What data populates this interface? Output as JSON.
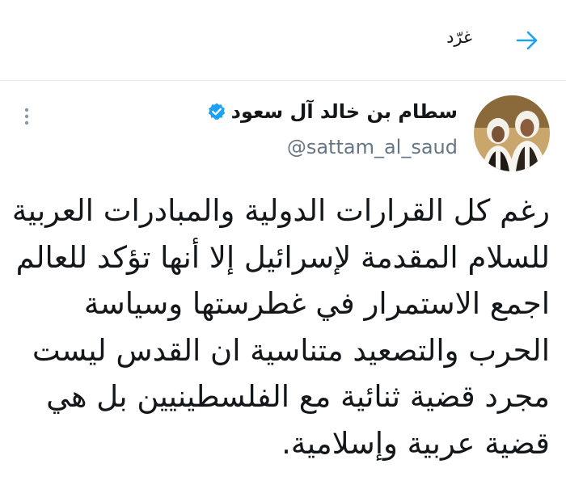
{
  "header": {
    "title": "غرّد",
    "back_icon": "arrow-right-icon",
    "accent_color": "#1da1f2"
  },
  "tweet": {
    "author": {
      "display_name": "سطام بن خالد آل سعود",
      "handle": "@sattam_al_saud",
      "verified": true,
      "verified_icon": "verified-badge-icon",
      "avatar_icon": "profile-photo"
    },
    "more_icon": "caret-down-icon",
    "text_lines": [
      "رغم كل القرارات الدولية والمبادرات العربية",
      "للسلام المقدمة لإسرائيل إلا أنها تؤكد للعالم",
      "اجمع الاستمرار في غطرستها وسياسة",
      "الحرب والتصعيد متناسية ان القدس ليست",
      "مجرد قضية ثنائية مع الفلسطينيين بل هي",
      "قضية عربية وإسلامية."
    ]
  }
}
